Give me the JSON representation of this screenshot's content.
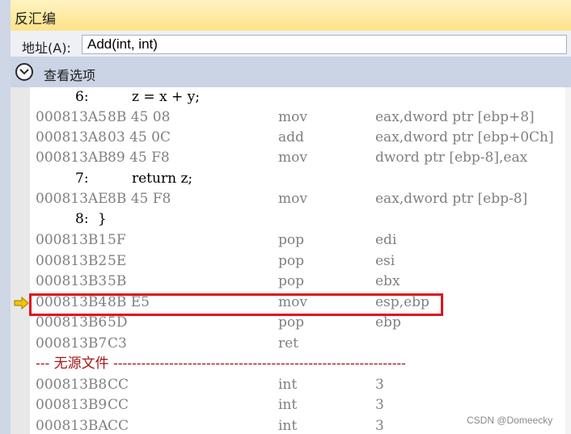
{
  "window": {
    "title": "反汇编"
  },
  "address": {
    "label": "地址(A):",
    "value": "Add(int, int)"
  },
  "options": {
    "label": "查看选项",
    "icon": "chevron-down-icon"
  },
  "lines": [
    {
      "kind": "src",
      "num": "6:",
      "text": "z = x + y;"
    },
    {
      "kind": "asm",
      "addr": "000813A5",
      "bytes": "8B 45 08",
      "mnemonic": "mov",
      "operands": "eax,dword ptr [ebp+8]"
    },
    {
      "kind": "asm",
      "addr": "000813A8",
      "bytes": "03 45 0C",
      "mnemonic": "add",
      "operands": "eax,dword ptr [ebp+0Ch]"
    },
    {
      "kind": "asm",
      "addr": "000813AB",
      "bytes": "89 45 F8",
      "mnemonic": "mov",
      "operands": "dword ptr [ebp-8],eax"
    },
    {
      "kind": "src",
      "num": "7:",
      "text": "return z;"
    },
    {
      "kind": "asm",
      "addr": "000813AE",
      "bytes": "8B 45 F8",
      "mnemonic": "mov",
      "operands": "eax,dword ptr [ebp-8]"
    },
    {
      "kind": "src",
      "num": "8:",
      "text": "}"
    },
    {
      "kind": "asm",
      "addr": "000813B1",
      "bytes": "5F",
      "mnemonic": "pop",
      "operands": "edi"
    },
    {
      "kind": "asm",
      "addr": "000813B2",
      "bytes": "5E",
      "mnemonic": "pop",
      "operands": "esi"
    },
    {
      "kind": "asm",
      "addr": "000813B3",
      "bytes": "5B",
      "mnemonic": "pop",
      "operands": "ebx"
    },
    {
      "kind": "asm",
      "addr": "000813B4",
      "bytes": "8B E5",
      "mnemonic": "mov",
      "operands": "esp,ebp",
      "current": true
    },
    {
      "kind": "asm",
      "addr": "000813B6",
      "bytes": "5D",
      "mnemonic": "pop",
      "operands": "ebp"
    },
    {
      "kind": "asm",
      "addr": "000813B7",
      "bytes": "C3",
      "mnemonic": "ret",
      "operands": ""
    },
    {
      "kind": "nosrc",
      "text": "--- 无源文件 ---------------------------------------------------------------"
    },
    {
      "kind": "asm",
      "addr": "000813B8",
      "bytes": "CC",
      "mnemonic": "int",
      "operands": "3"
    },
    {
      "kind": "asm",
      "addr": "000813B9",
      "bytes": "CC",
      "mnemonic": "int",
      "operands": "3"
    },
    {
      "kind": "asm",
      "addr": "000813BA",
      "bytes": "CC",
      "mnemonic": "int",
      "operands": "3"
    }
  ],
  "current_instruction_marker": "current-instruction-arrow-icon",
  "watermark": "CSDN @Domeecky",
  "colors": {
    "highlight_border": "#e0141e",
    "arrow": "#f5c400",
    "nosrc_text": "#a31515",
    "disasm_text": "#808080"
  }
}
